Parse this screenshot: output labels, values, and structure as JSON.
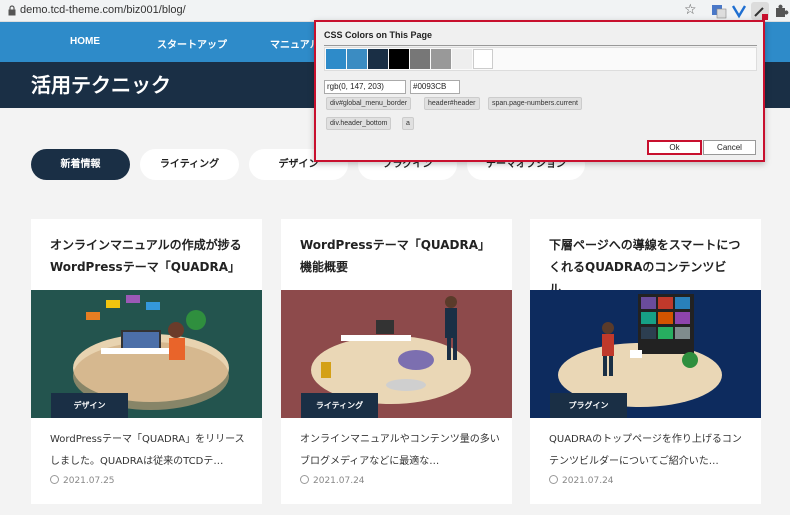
{
  "browser": {
    "url": "demo.tcd-theme.com/biz001/blog/",
    "bookmark_icon": "star-icon",
    "extensions": [
      "translate-icon",
      "vpn-icon",
      "eyedropper-icon",
      "puzzle-icon"
    ]
  },
  "nav": {
    "items": [
      "HOME",
      "スタートアップ",
      "マニュアル"
    ]
  },
  "page": {
    "title": "活用テクニック"
  },
  "filters": [
    "新着情報",
    "ライティング",
    "デザイン",
    "プラグイン",
    "テーマオプション"
  ],
  "cards": [
    {
      "title": "オンラインマニュアルの作成が捗るWordPressテーマ「QUADRA」",
      "category": "デザイン",
      "excerpt": "WordPressテーマ「QUADRA」をリリースしました。QUADRAは従来のTCDテ…",
      "date": "2021.07.25",
      "thumb_bg": "#23544e"
    },
    {
      "title": "WordPressテーマ「QUADRA」機能概要",
      "category": "ライティング",
      "excerpt": "オンラインマニュアルやコンテンツ量の多いブログメディアなどに最適な…",
      "date": "2021.07.24",
      "thumb_bg": "#8d4a4b"
    },
    {
      "title": "下層ページへの導線をスマートにつくれるQUADRAのコンテンツビル…",
      "category": "プラグイン",
      "excerpt": "QUADRAのトップページを作り上げるコンテンツビルダーについてご紹介いた…",
      "date": "2021.07.24",
      "thumb_bg": "#0d2b5e"
    }
  ],
  "popup": {
    "title": "CSS Colors on This Page",
    "swatches": [
      "#2e8bc9",
      "#3b8cc2",
      "#1a2f45",
      "#000000",
      "#777777",
      "#999999",
      "#eeeeee",
      "#ffffff"
    ],
    "rgb_value": "rgb(0, 147, 203)",
    "hex_value": "#0093CB",
    "tags": [
      "div#global_menu_border",
      "header#header",
      "span.page-numbers.current",
      "div.header_bottom",
      "a"
    ],
    "ok_label": "Ok",
    "cancel_label": "Cancel"
  }
}
